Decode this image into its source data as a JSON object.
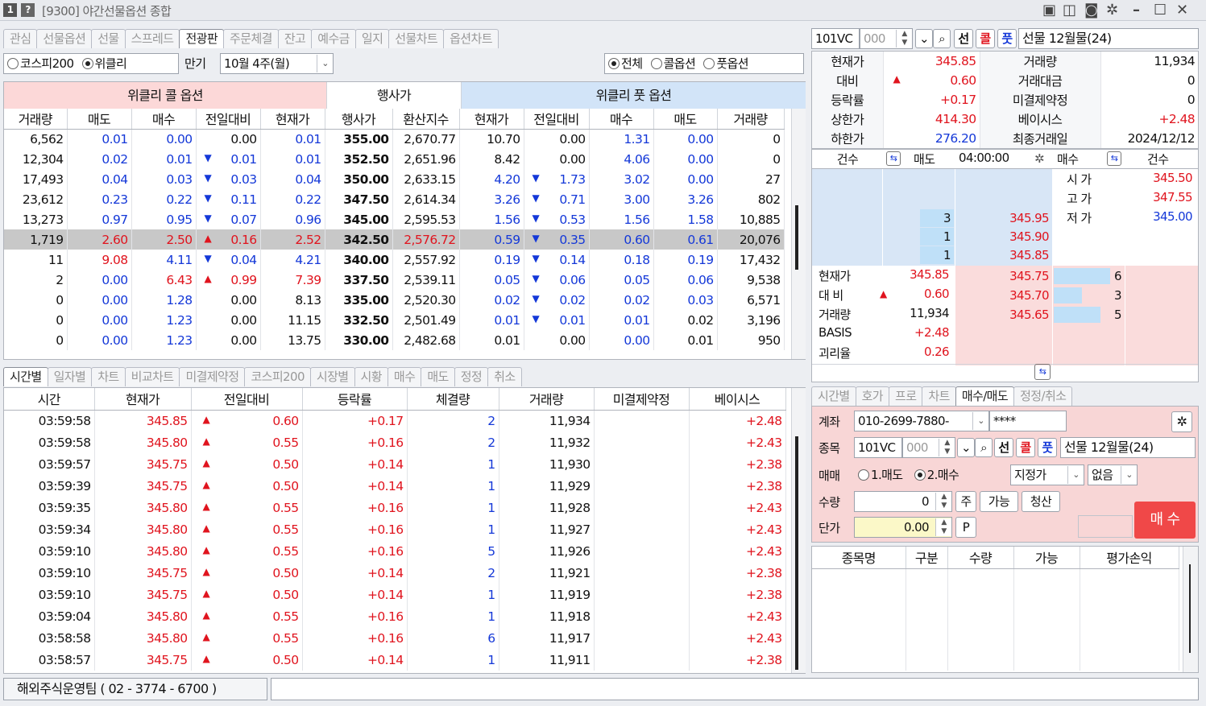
{
  "window": {
    "num1": "1",
    "num2": "?",
    "title": "[9300] 야간선물옵션 종합"
  },
  "main_tabs": [
    "관심",
    "선물옵션",
    "선물",
    "스프레드",
    "전광판",
    "주문체결",
    "잔고",
    "예수금",
    "일지",
    "선물차트",
    "옵션차트"
  ],
  "filters": {
    "radio_kospi200": "코스피200",
    "radio_weekly": "위클리",
    "expiry_label": "만기",
    "expiry_value": "10월 4주(월)",
    "radio_all": "전체",
    "radio_call": "콜옵션",
    "radio_put": "풋옵션"
  },
  "board": {
    "call_title": "위클리 콜 옵션",
    "strike_title": "행사가",
    "put_title": "위클리 풋 옵션",
    "headers": [
      "거래량",
      "매도",
      "매수",
      "전일대비",
      "현재가",
      "행사가",
      "환산지수",
      "현재가",
      "전일대비",
      "매수",
      "매도",
      "거래량"
    ],
    "rows": [
      [
        "6,562",
        "0.01",
        "0.00",
        "",
        "0.00",
        "0.01",
        "355.00",
        "2,670.77",
        "10.70",
        "",
        "0.00",
        "1.31",
        "0.00",
        "0"
      ],
      [
        "12,304",
        "0.02",
        "0.01",
        "▼",
        "0.01",
        "0.01",
        "352.50",
        "2,651.96",
        "8.42",
        "",
        "0.00",
        "4.06",
        "0.00",
        "0"
      ],
      [
        "17,493",
        "0.04",
        "0.03",
        "▼",
        "0.03",
        "0.04",
        "350.00",
        "2,633.15",
        "4.20",
        "▼",
        "1.73",
        "3.02",
        "0.00",
        "27"
      ],
      [
        "23,612",
        "0.23",
        "0.22",
        "▼",
        "0.11",
        "0.22",
        "347.50",
        "2,614.34",
        "3.26",
        "▼",
        "0.71",
        "3.00",
        "3.26",
        "802"
      ],
      [
        "13,273",
        "0.97",
        "0.95",
        "▼",
        "0.07",
        "0.96",
        "345.00",
        "2,595.53",
        "1.56",
        "▼",
        "0.53",
        "1.56",
        "1.58",
        "10,885"
      ],
      [
        "1,719",
        "2.60",
        "2.50",
        "▲",
        "0.16",
        "2.52",
        "342.50",
        "2,576.72",
        "0.59",
        "▼",
        "0.35",
        "0.60",
        "0.61",
        "20,076"
      ],
      [
        "11",
        "9.08",
        "4.11",
        "▼",
        "0.04",
        "4.21",
        "340.00",
        "2,557.92",
        "0.19",
        "▼",
        "0.14",
        "0.18",
        "0.19",
        "17,432"
      ],
      [
        "2",
        "0.00",
        "6.43",
        "▲",
        "0.99",
        "7.39",
        "337.50",
        "2,539.11",
        "0.05",
        "▼",
        "0.06",
        "0.05",
        "0.06",
        "9,538"
      ],
      [
        "0",
        "0.00",
        "1.28",
        "",
        "0.00",
        "8.13",
        "335.00",
        "2,520.30",
        "0.02",
        "▼",
        "0.02",
        "0.02",
        "0.03",
        "6,571"
      ],
      [
        "0",
        "0.00",
        "1.23",
        "",
        "0.00",
        "11.15",
        "332.50",
        "2,501.49",
        "0.01",
        "▼",
        "0.01",
        "0.01",
        "0.02",
        "3,196"
      ],
      [
        "0",
        "0.00",
        "1.23",
        "",
        "0.00",
        "13.75",
        "330.00",
        "2,482.68",
        "0.01",
        "",
        "0.00",
        "0.00",
        "0.01",
        "950"
      ]
    ]
  },
  "sub_tabs": [
    "시간별",
    "일자별",
    "차트",
    "비교차트",
    "미결제약정",
    "코스피200",
    "시장별",
    "시황",
    "매수",
    "매도",
    "정정",
    "취소"
  ],
  "ticks": {
    "headers": [
      "시간",
      "현재가",
      "전일대비",
      "등락률",
      "체결량",
      "거래량",
      "미결제약정",
      "베이시스"
    ],
    "rows": [
      [
        "03:59:58",
        "345.85",
        "▲",
        "0.60",
        "+0.17",
        "2",
        "11,934",
        "",
        "+2.48"
      ],
      [
        "03:59:58",
        "345.80",
        "▲",
        "0.55",
        "+0.16",
        "2",
        "11,932",
        "",
        "+2.43"
      ],
      [
        "03:59:57",
        "345.75",
        "▲",
        "0.50",
        "+0.14",
        "1",
        "11,930",
        "",
        "+2.38"
      ],
      [
        "03:59:39",
        "345.75",
        "▲",
        "0.50",
        "+0.14",
        "1",
        "11,929",
        "",
        "+2.38"
      ],
      [
        "03:59:35",
        "345.80",
        "▲",
        "0.55",
        "+0.16",
        "1",
        "11,928",
        "",
        "+2.43"
      ],
      [
        "03:59:34",
        "345.80",
        "▲",
        "0.55",
        "+0.16",
        "1",
        "11,927",
        "",
        "+2.43"
      ],
      [
        "03:59:10",
        "345.80",
        "▲",
        "0.55",
        "+0.16",
        "5",
        "11,926",
        "",
        "+2.43"
      ],
      [
        "03:59:10",
        "345.75",
        "▲",
        "0.50",
        "+0.14",
        "2",
        "11,921",
        "",
        "+2.38"
      ],
      [
        "03:59:10",
        "345.75",
        "▲",
        "0.50",
        "+0.14",
        "1",
        "11,919",
        "",
        "+2.38"
      ],
      [
        "03:59:04",
        "345.80",
        "▲",
        "0.55",
        "+0.16",
        "1",
        "11,918",
        "",
        "+2.43"
      ],
      [
        "03:58:58",
        "345.80",
        "▲",
        "0.55",
        "+0.16",
        "6",
        "11,917",
        "",
        "+2.43"
      ],
      [
        "03:58:57",
        "345.75",
        "▲",
        "0.50",
        "+0.14",
        "1",
        "11,911",
        "",
        "+2.38"
      ]
    ]
  },
  "status": {
    "contact": "해외주식운영팀 ( 02 - 3774 - 6700 )"
  },
  "quote": {
    "code": "101VC",
    "subcode": "000",
    "btn_f": "선",
    "btn_c": "콜",
    "btn_p": "풋",
    "name": "선물 12월물(24)",
    "rows": [
      {
        "k1": "현재가",
        "v1": "345.85",
        "k2": "거래량",
        "v2": "11,934"
      },
      {
        "k1": "대비",
        "v1": "0.60",
        "k2": "거래대금",
        "v2": "0"
      },
      {
        "k1": "등락률",
        "v1": "+0.17",
        "k2": "미결제약정",
        "v2": "0"
      },
      {
        "k1": "상한가",
        "v1": "414.30",
        "k2": "베이시스",
        "v2": "+2.48"
      },
      {
        "k1": "하한가",
        "v1": "276.20",
        "k2": "최종거래일",
        "v2": "2024/12/12"
      }
    ],
    "up_arrow": "▲"
  },
  "orderbook": {
    "h_count": "건수",
    "h_ask": "매도",
    "h_time": "04:00:00",
    "h_bid": "매수",
    "h_count2": "건수",
    "asks": [
      {
        "qty": "3",
        "price": "345.95"
      },
      {
        "qty": "1",
        "price": "345.90"
      },
      {
        "qty": "1",
        "price": "345.85"
      }
    ],
    "bids": [
      {
        "price": "345.75",
        "qty": "6",
        "fill": 1.0
      },
      {
        "price": "345.70",
        "qty": "3",
        "fill": 0.5
      },
      {
        "price": "345.65",
        "qty": "5",
        "fill": 0.83
      }
    ],
    "ohl": [
      {
        "k": "시  가",
        "v": "345.50"
      },
      {
        "k": "고  가",
        "v": "347.55"
      },
      {
        "k": "저  가",
        "v": "345.00"
      }
    ],
    "info": [
      {
        "k": "현재가",
        "v": "345.85"
      },
      {
        "k": "대  비",
        "v": "0.60"
      },
      {
        "k": "거래량",
        "v": "11,934"
      },
      {
        "k": "BASIS",
        "v": "+2.48"
      },
      {
        "k": "괴리율",
        "v": "0.26"
      }
    ]
  },
  "order_tabs": [
    "시간별",
    "호가",
    "프로",
    "차트",
    "매수/매도",
    "정정/취소"
  ],
  "order": {
    "account_label": "계좌",
    "account": "010-2699-7880-",
    "password": "****",
    "item_label": "종목",
    "code": "101VC",
    "subcode": "000",
    "btn_f": "선",
    "btn_c": "콜",
    "btn_p": "풋",
    "name": "선물 12월물(24)",
    "side_label": "매매",
    "sell": "1.매도",
    "buy": "2.매수",
    "price_type": "지정가",
    "condition": "없음",
    "qty_label": "수량",
    "qty": "0",
    "btn_ju": "주",
    "btn_avail": "가능",
    "btn_clear": "청산",
    "price_label": "단가",
    "price": "0.00",
    "btn_p2": "P",
    "submit": "매 수"
  },
  "balance": {
    "headers": [
      "종목명",
      "구분",
      "수량",
      "가능",
      "평가손익"
    ]
  }
}
